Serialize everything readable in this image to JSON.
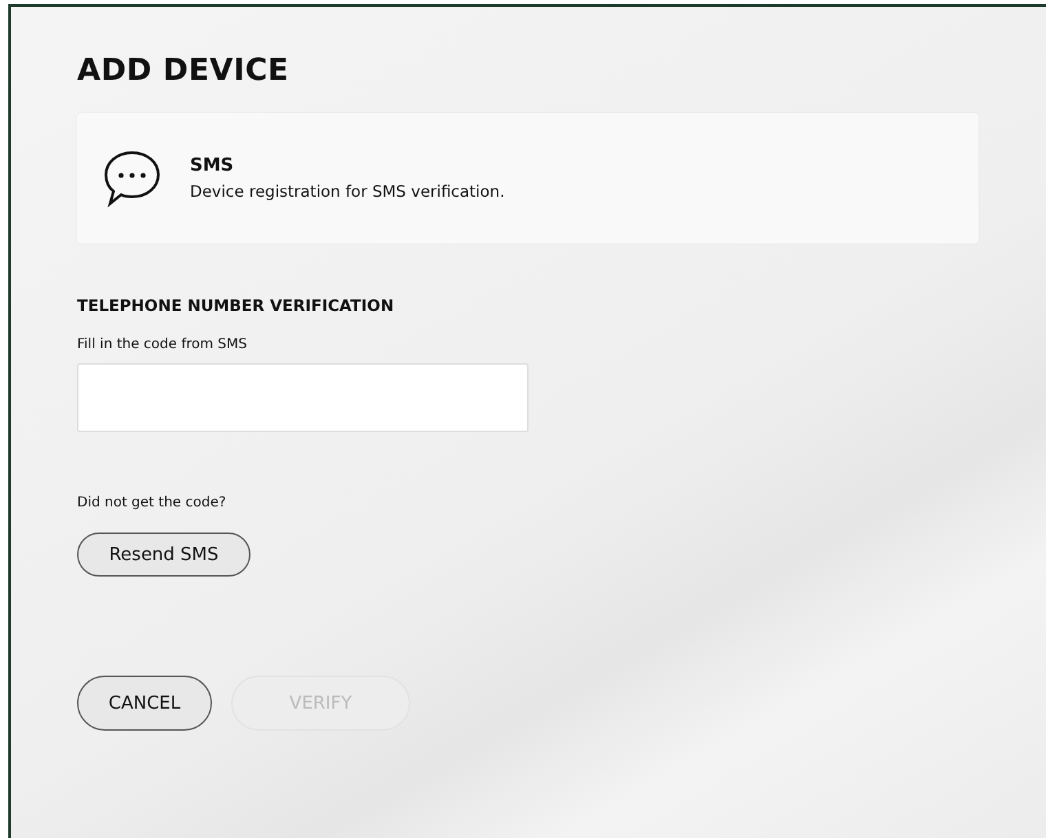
{
  "title": "ADD DEVICE",
  "method": {
    "name": "SMS",
    "description": "Device registration for SMS verification."
  },
  "section_title": "TELEPHONE NUMBER VERIFICATION",
  "code_field": {
    "label": "Fill in the code from SMS"
  },
  "resend": {
    "prompt": "Did not get the code?",
    "button": "Resend SMS"
  },
  "buttons": [
    {
      "label": "CANCEL",
      "disabled": false
    },
    {
      "label": "VERIFY",
      "disabled": true
    }
  ]
}
